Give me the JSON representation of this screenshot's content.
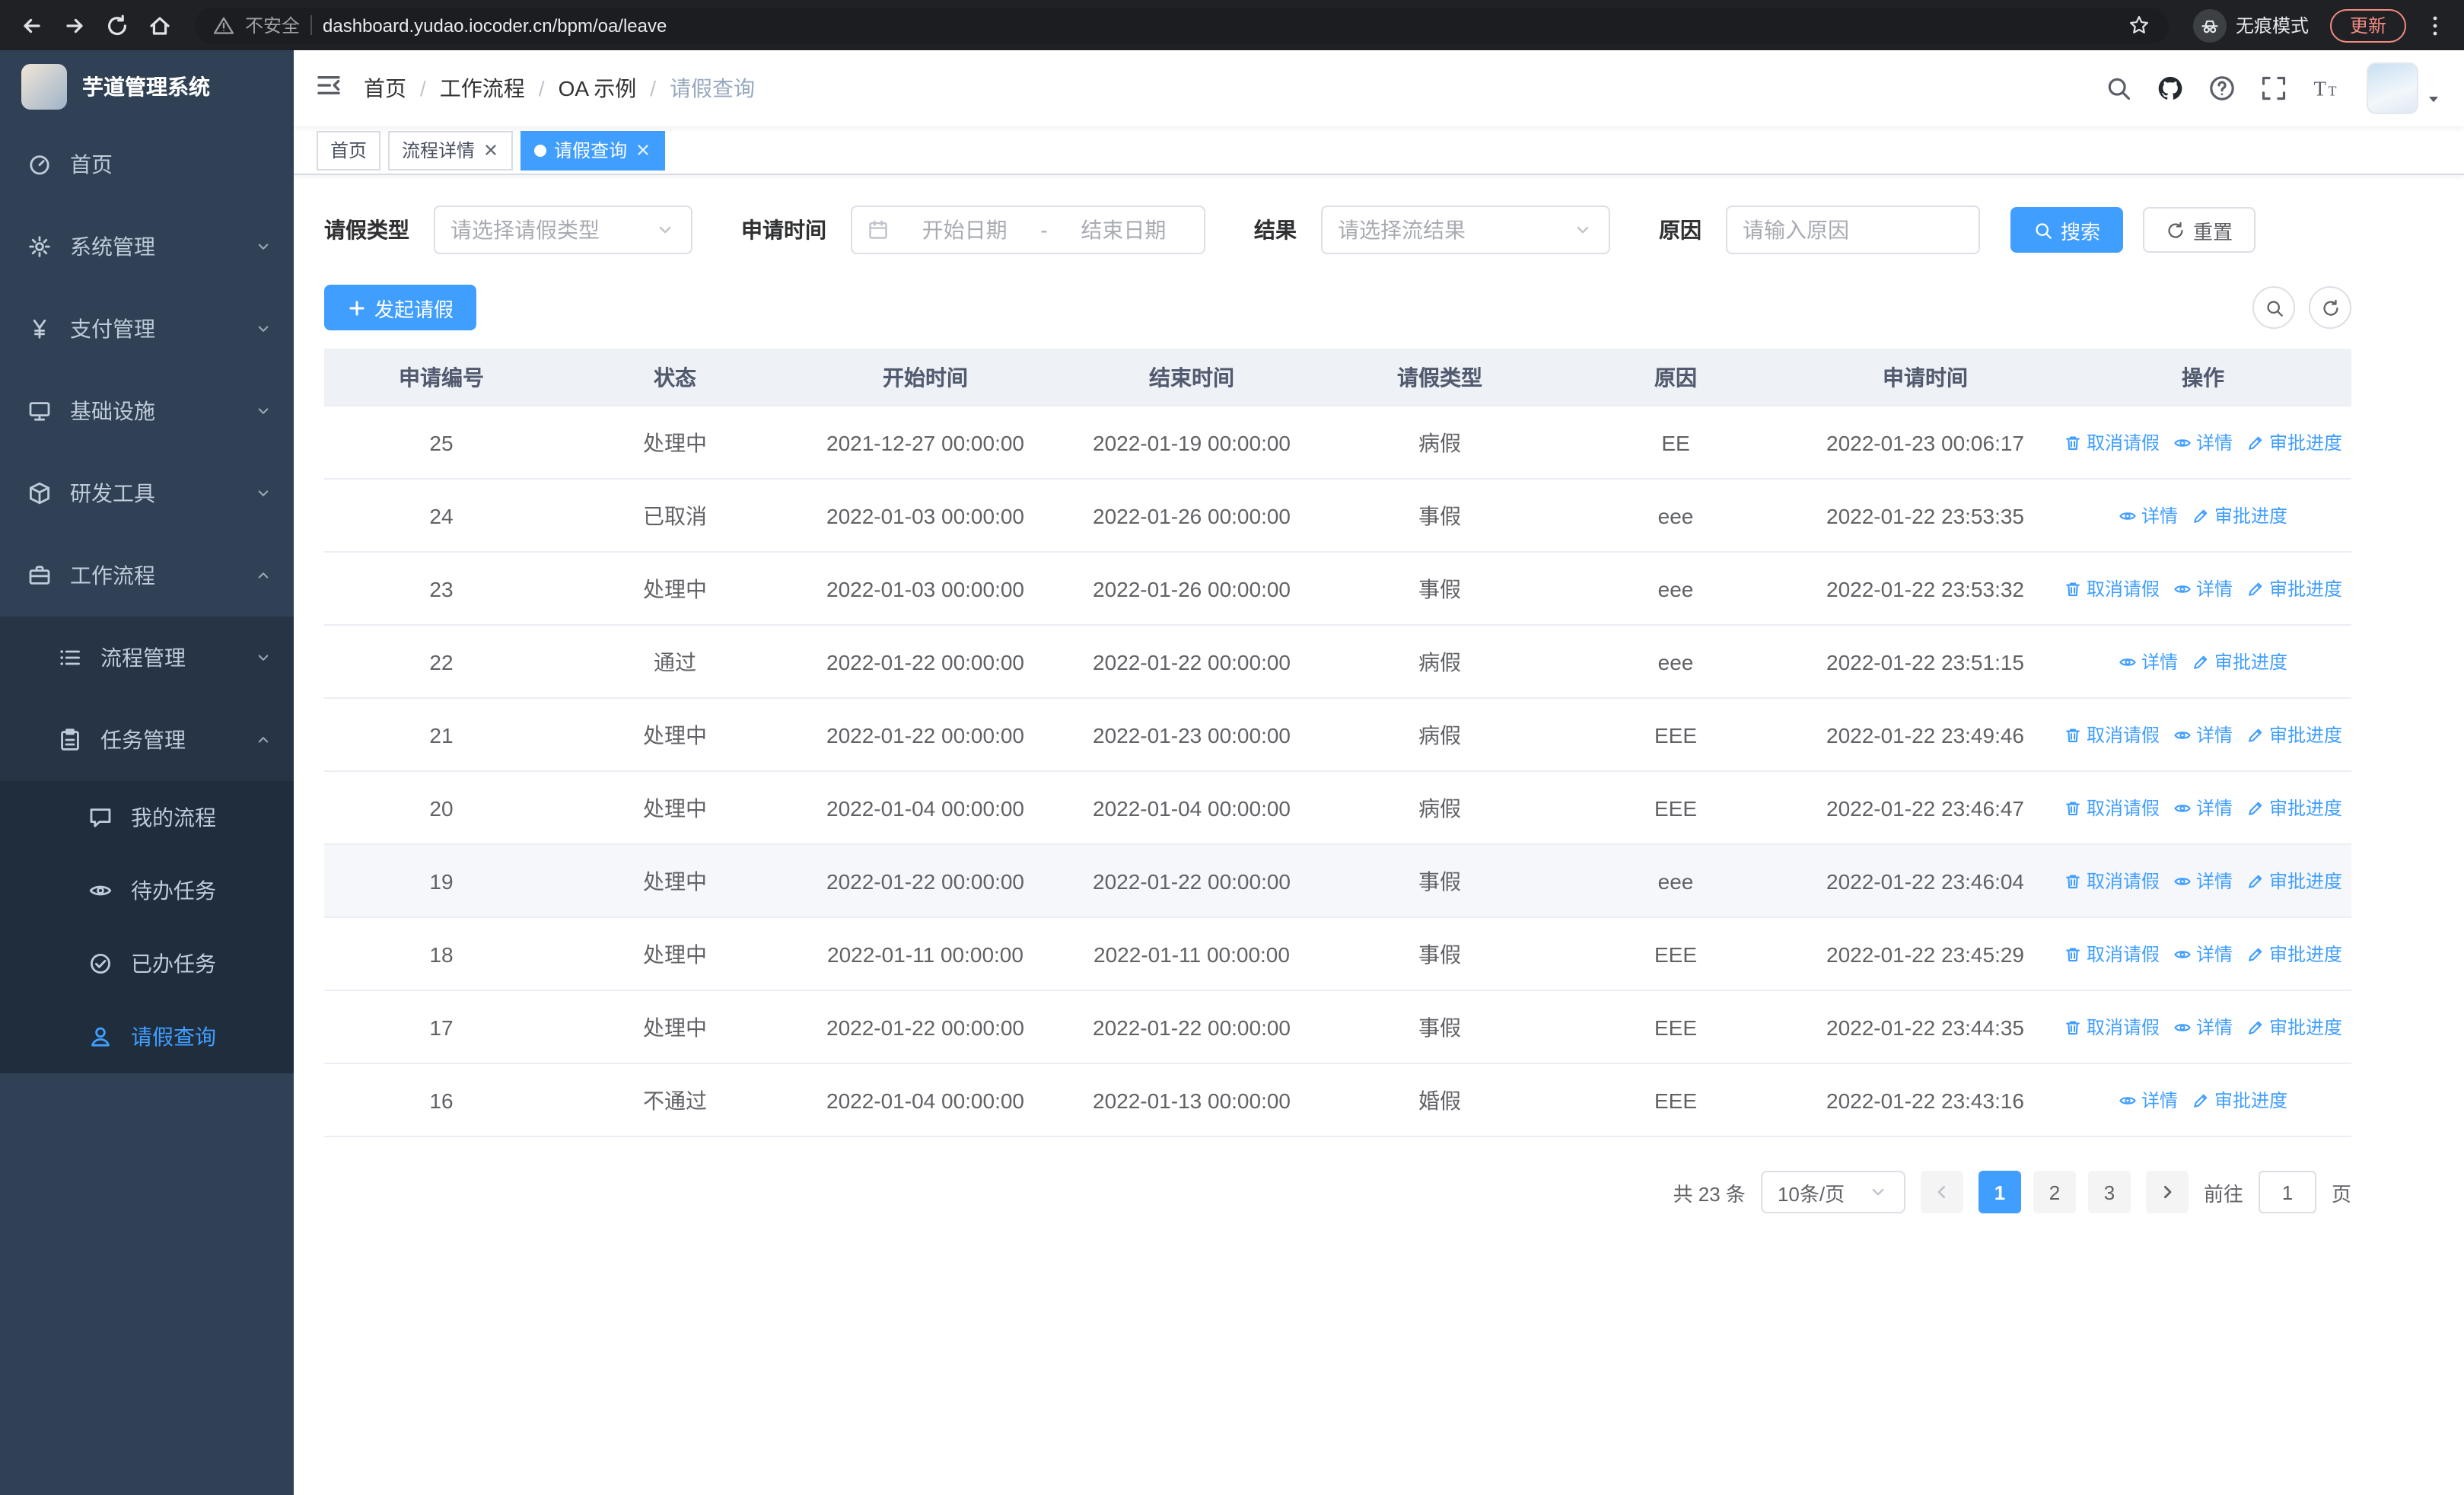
{
  "colors": {
    "primary": "#409eff",
    "link": "#409eff",
    "sidebar_bg": "#304156",
    "sidebar_sub_bg": "#263445",
    "sidebar_deep_bg": "#1f2d3d",
    "sidebar_text": "#bfcbd9",
    "update_accent": "#f28b82"
  },
  "browser": {
    "security_label": "不安全",
    "url": "dashboard.yudao.iocoder.cn/bpm/oa/leave",
    "incognito_label": "无痕模式",
    "update_label": "更新"
  },
  "sidebar": {
    "logo_title": "芋道管理系统",
    "items": [
      {
        "label": "首页",
        "icon": "home-icon",
        "level": 1
      },
      {
        "label": "系统管理",
        "icon": "gear-icon",
        "level": 1,
        "arrow": "down"
      },
      {
        "label": "支付管理",
        "icon": "yen-icon",
        "level": 1,
        "arrow": "down"
      },
      {
        "label": "基础设施",
        "icon": "infra-icon",
        "level": 1,
        "arrow": "down"
      },
      {
        "label": "研发工具",
        "icon": "tools-icon",
        "level": 1,
        "arrow": "down"
      },
      {
        "label": "工作流程",
        "icon": "workflow-icon",
        "level": 1,
        "arrow": "up"
      },
      {
        "label": "流程管理",
        "icon": "process-icon",
        "level": 2,
        "arrow": "down"
      },
      {
        "label": "任务管理",
        "icon": "task-icon",
        "level": 2,
        "arrow": "up"
      },
      {
        "label": "我的流程",
        "icon": "my-process-icon",
        "level": 3
      },
      {
        "label": "待办任务",
        "icon": "eye-icon",
        "level": 3
      },
      {
        "label": "已办任务",
        "icon": "done-icon",
        "level": 3
      },
      {
        "label": "请假查询",
        "icon": "user-icon",
        "level": 3,
        "active": true
      }
    ]
  },
  "header": {
    "breadcrumb": {
      "items": [
        "首页",
        "工作流程",
        "OA 示例",
        "请假查询"
      ],
      "separator": "/"
    },
    "icons": [
      "search-icon",
      "github-icon",
      "help-icon",
      "fullscreen-icon",
      "font-size-icon"
    ]
  },
  "tabs": [
    {
      "label": "首页",
      "closable": false,
      "active": false
    },
    {
      "label": "流程详情",
      "closable": true,
      "active": false
    },
    {
      "label": "请假查询",
      "closable": true,
      "active": true
    }
  ],
  "filters": {
    "leave_type_label": "请假类型",
    "leave_type_placeholder": "请选择请假类型",
    "apply_time_label": "申请时间",
    "start_date_placeholder": "开始日期",
    "range_separator": "-",
    "end_date_placeholder": "结束日期",
    "result_label": "结果",
    "result_placeholder": "请选择流结果",
    "reason_label": "原因",
    "reason_placeholder": "请输入原因",
    "search_label": "搜索",
    "reset_label": "重置"
  },
  "toolbar": {
    "create_label": "发起请假",
    "right_icons": [
      "search-icon",
      "refresh-icon"
    ]
  },
  "table": {
    "columns": [
      "申请编号",
      "状态",
      "开始时间",
      "结束时间",
      "请假类型",
      "原因",
      "申请时间",
      "操作"
    ],
    "action_labels": {
      "cancel": "取消请假",
      "detail": "详情",
      "progress": "审批进度"
    },
    "rows": [
      {
        "id": "25",
        "status": "处理中",
        "start": "2021-12-27 00:00:00",
        "end": "2022-01-19 00:00:00",
        "type": "病假",
        "reason": "EE",
        "apply_time": "2022-01-23 00:06:17",
        "actions": [
          "cancel",
          "detail",
          "progress"
        ]
      },
      {
        "id": "24",
        "status": "已取消",
        "start": "2022-01-03 00:00:00",
        "end": "2022-01-26 00:00:00",
        "type": "事假",
        "reason": "eee",
        "apply_time": "2022-01-22 23:53:35",
        "actions": [
          "detail",
          "progress"
        ]
      },
      {
        "id": "23",
        "status": "处理中",
        "start": "2022-01-03 00:00:00",
        "end": "2022-01-26 00:00:00",
        "type": "事假",
        "reason": "eee",
        "apply_time": "2022-01-22 23:53:32",
        "actions": [
          "cancel",
          "detail",
          "progress"
        ]
      },
      {
        "id": "22",
        "status": "通过",
        "start": "2022-01-22 00:00:00",
        "end": "2022-01-22 00:00:00",
        "type": "病假",
        "reason": "eee",
        "apply_time": "2022-01-22 23:51:15",
        "actions": [
          "detail",
          "progress"
        ]
      },
      {
        "id": "21",
        "status": "处理中",
        "start": "2022-01-22 00:00:00",
        "end": "2022-01-23 00:00:00",
        "type": "病假",
        "reason": "EEE",
        "apply_time": "2022-01-22 23:49:46",
        "actions": [
          "cancel",
          "detail",
          "progress"
        ]
      },
      {
        "id": "20",
        "status": "处理中",
        "start": "2022-01-04 00:00:00",
        "end": "2022-01-04 00:00:00",
        "type": "病假",
        "reason": "EEE",
        "apply_time": "2022-01-22 23:46:47",
        "actions": [
          "cancel",
          "detail",
          "progress"
        ]
      },
      {
        "id": "19",
        "status": "处理中",
        "start": "2022-01-22 00:00:00",
        "end": "2022-01-22 00:00:00",
        "type": "事假",
        "reason": "eee",
        "apply_time": "2022-01-22 23:46:04",
        "actions": [
          "cancel",
          "detail",
          "progress"
        ],
        "highlighted": true
      },
      {
        "id": "18",
        "status": "处理中",
        "start": "2022-01-11 00:00:00",
        "end": "2022-01-11 00:00:00",
        "type": "事假",
        "reason": "EEE",
        "apply_time": "2022-01-22 23:45:29",
        "actions": [
          "cancel",
          "detail",
          "progress"
        ]
      },
      {
        "id": "17",
        "status": "处理中",
        "start": "2022-01-22 00:00:00",
        "end": "2022-01-22 00:00:00",
        "type": "事假",
        "reason": "EEE",
        "apply_time": "2022-01-22 23:44:35",
        "actions": [
          "cancel",
          "detail",
          "progress"
        ]
      },
      {
        "id": "16",
        "status": "不通过",
        "start": "2022-01-04 00:00:00",
        "end": "2022-01-13 00:00:00",
        "type": "婚假",
        "reason": "EEE",
        "apply_time": "2022-01-22 23:43:16",
        "actions": [
          "detail",
          "progress"
        ]
      }
    ]
  },
  "pagination": {
    "total_label": "共 23 条",
    "page_size_label": "10条/页",
    "pages": [
      "1",
      "2",
      "3"
    ],
    "active_page": "1",
    "goto_label": "前往",
    "goto_value": "1",
    "goto_suffix": "页"
  }
}
